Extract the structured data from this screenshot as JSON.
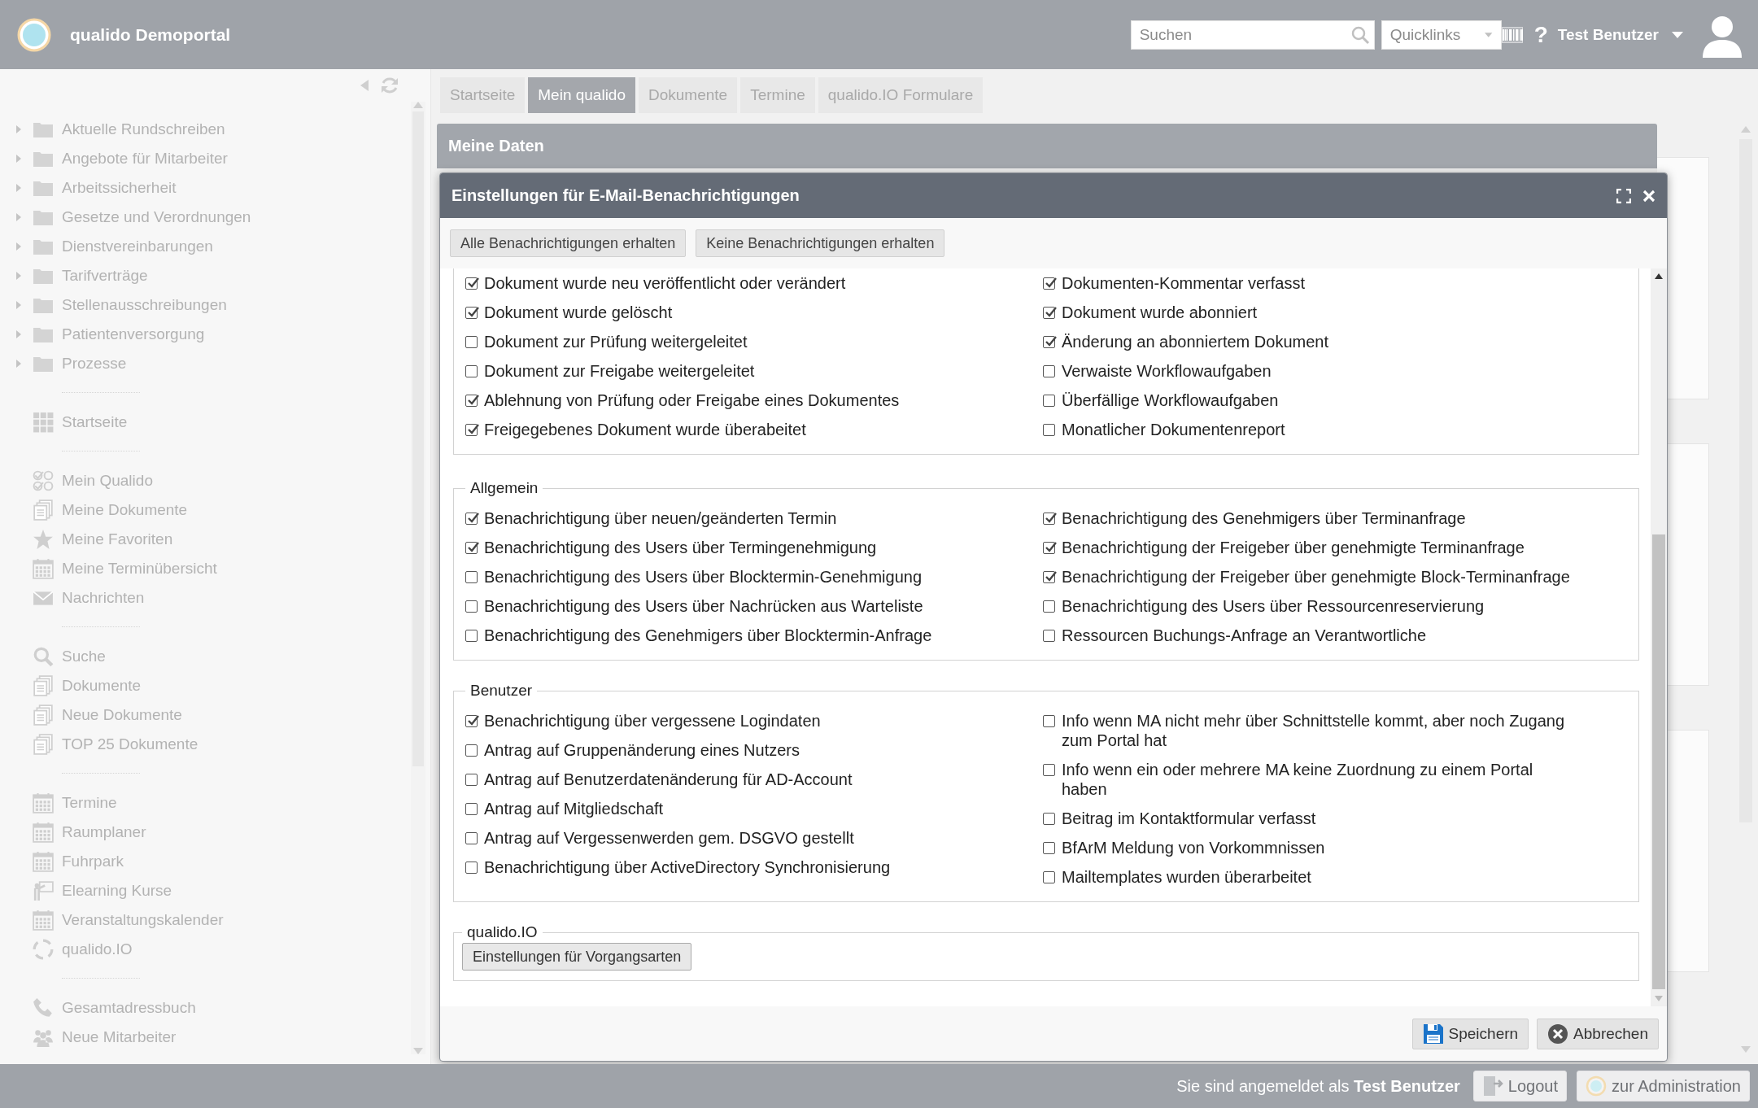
{
  "header": {
    "title": "qualido Demoportal",
    "search": {
      "placeholder": "Suchen"
    },
    "quicklinks": "Quicklinks",
    "help": "?",
    "user": "Test Benutzer"
  },
  "sidebar": {
    "folders": [
      {
        "label": "Aktuelle Rundschreiben",
        "expanded": false
      },
      {
        "label": "Angebote für Mitarbeiter",
        "expanded": false
      },
      {
        "label": "Arbeitssicherheit",
        "expanded": false
      },
      {
        "label": "Gesetze und Verordnungen",
        "expanded": false
      },
      {
        "label": "Dienstvereinbarungen",
        "expanded": false
      },
      {
        "label": "Tarifverträge",
        "expanded": false
      },
      {
        "label": "Stellenausschreibungen",
        "expanded": false
      },
      {
        "label": "Patientenversorgung",
        "expanded": false
      },
      {
        "label": "Prozesse",
        "expanded": false
      }
    ],
    "groups": [
      [
        {
          "label": "Startseite",
          "kind": "grid"
        }
      ],
      [
        {
          "label": "Mein Qualido",
          "kind": "checks"
        },
        {
          "label": "Meine Dokumente",
          "kind": "docs"
        },
        {
          "label": "Meine Favoriten",
          "kind": "star"
        },
        {
          "label": "Meine Terminübersicht",
          "kind": "calendar"
        },
        {
          "label": "Nachrichten",
          "kind": "mail"
        }
      ],
      [
        {
          "label": "Suche",
          "kind": "search"
        },
        {
          "label": "Dokumente",
          "kind": "docs"
        },
        {
          "label": "Neue Dokumente",
          "kind": "docs"
        },
        {
          "label": "TOP 25 Dokumente",
          "kind": "docs"
        }
      ],
      [
        {
          "label": "Termine",
          "kind": "calendar"
        },
        {
          "label": "Raumplaner",
          "kind": "calendar"
        },
        {
          "label": "Fuhrpark",
          "kind": "calendar"
        },
        {
          "label": "Elearning Kurse",
          "kind": "teacher"
        },
        {
          "label": "Veranstaltungskalender",
          "kind": "calendar"
        },
        {
          "label": "qualido.IO",
          "kind": "cycle"
        }
      ],
      [
        {
          "label": "Gesamtadressbuch",
          "kind": "phone"
        },
        {
          "label": "Neue Mitarbeiter",
          "kind": "people"
        }
      ]
    ]
  },
  "tabs": [
    {
      "label": "Startseite",
      "selected": false
    },
    {
      "label": "Mein qualido",
      "selected": true
    },
    {
      "label": "Dokumente",
      "selected": false
    },
    {
      "label": "Termine",
      "selected": false
    },
    {
      "label": "qualido.IO Formulare",
      "selected": false
    }
  ],
  "panel_title": "Meine Daten",
  "dialog": {
    "title": "Einstellungen für E-Mail-Benachrichtigungen",
    "top_buttons": [
      "Alle Benachrichtigungen erhalten",
      "Keine Benachrichtigungen erhalten"
    ],
    "sections": [
      {
        "left": [
          {
            "label": "Dokument wurde neu veröffentlicht oder verändert",
            "checked": true
          },
          {
            "label": "Dokument wurde gelöscht",
            "checked": true
          },
          {
            "label": "Dokument zur Prüfung weitergeleitet",
            "checked": false
          },
          {
            "label": "Dokument zur Freigabe weitergeleitet",
            "checked": false
          },
          {
            "label": "Ablehnung von Prüfung oder Freigabe eines Dokumentes",
            "checked": true
          },
          {
            "label": "Freigegebenes Dokument wurde überabeitet",
            "checked": true
          }
        ],
        "right": [
          {
            "label": "Dokumenten-Kommentar verfasst",
            "checked": true
          },
          {
            "label": "Dokument wurde abonniert",
            "checked": true
          },
          {
            "label": "Änderung an abonniertem Dokument",
            "checked": true
          },
          {
            "label": "Verwaiste Workflowaufgaben",
            "checked": false
          },
          {
            "label": "Überfällige Workflowaufgaben",
            "checked": false
          },
          {
            "label": "Monatlicher Dokumentenreport",
            "checked": false
          }
        ]
      },
      {
        "legend": "Allgemein",
        "left": [
          {
            "label": "Benachrichtigung über neuen/geänderten Termin",
            "checked": true
          },
          {
            "label": "Benachrichtigung des Users über Termingenehmigung",
            "checked": true
          },
          {
            "label": "Benachrichtigung des Users über Blocktermin-Genehmigung",
            "checked": false
          },
          {
            "label": "Benachrichtigung des Users über Nachrücken aus Warteliste",
            "checked": false
          },
          {
            "label": "Benachrichtigung des Genehmigers über Blocktermin-Anfrage",
            "checked": false
          }
        ],
        "right": [
          {
            "label": "Benachrichtigung des Genehmigers über Terminanfrage",
            "checked": true
          },
          {
            "label": "Benachrichtigung der Freigeber über genehmigte Terminanfrage",
            "checked": true
          },
          {
            "label": "Benachrichtigung der Freigeber über genehmigte Block-Terminanfrage",
            "checked": true
          },
          {
            "label": "Benachrichtigung des Users über Ressourcenreservierung",
            "checked": false
          },
          {
            "label": "Ressourcen Buchungs-Anfrage an Verantwortliche",
            "checked": false
          }
        ]
      },
      {
        "legend": "Benutzer",
        "left": [
          {
            "label": "Benachrichtigung über vergessene Logindaten",
            "checked": true
          },
          {
            "label": "Antrag auf Gruppenänderung eines Nutzers",
            "checked": false
          },
          {
            "label": "Antrag auf Benutzerdatenänderung für AD-Account",
            "checked": false
          },
          {
            "label": "Antrag auf Mitgliedschaft",
            "checked": false
          },
          {
            "label": "Antrag auf Vergessenwerden gem. DSGVO gestellt",
            "checked": false
          },
          {
            "label": "Benachrichtigung über ActiveDirectory Synchronisierung",
            "checked": false
          }
        ],
        "right": [
          {
            "label": "Info wenn MA nicht mehr über Schnittstelle kommt, aber noch Zugang zum Portal hat",
            "checked": false
          },
          {
            "label": "Info wenn ein oder mehrere MA keine Zuordnung zu einem Portal haben",
            "checked": false
          },
          {
            "label": "Beitrag im Kontaktformular verfasst",
            "checked": false
          },
          {
            "label": "BfArM Meldung von Vorkommnissen",
            "checked": false
          },
          {
            "label": "Mailtemplates wurden überarbeitet",
            "checked": false
          }
        ]
      }
    ],
    "io_section": {
      "legend": "qualido.IO",
      "button": "Einstellungen für Vorgangsarten"
    },
    "buttons": [
      {
        "label": "Speichern",
        "kind": "save"
      },
      {
        "label": "Abbrechen",
        "kind": "cancel"
      }
    ]
  },
  "footer": {
    "login_text": "Sie sind angemeldet als **Test Benutzer**",
    "buttons": [
      {
        "label": "Logout",
        "kind": "logout"
      },
      {
        "label": "zur Administration",
        "kind": "admin"
      }
    ]
  }
}
